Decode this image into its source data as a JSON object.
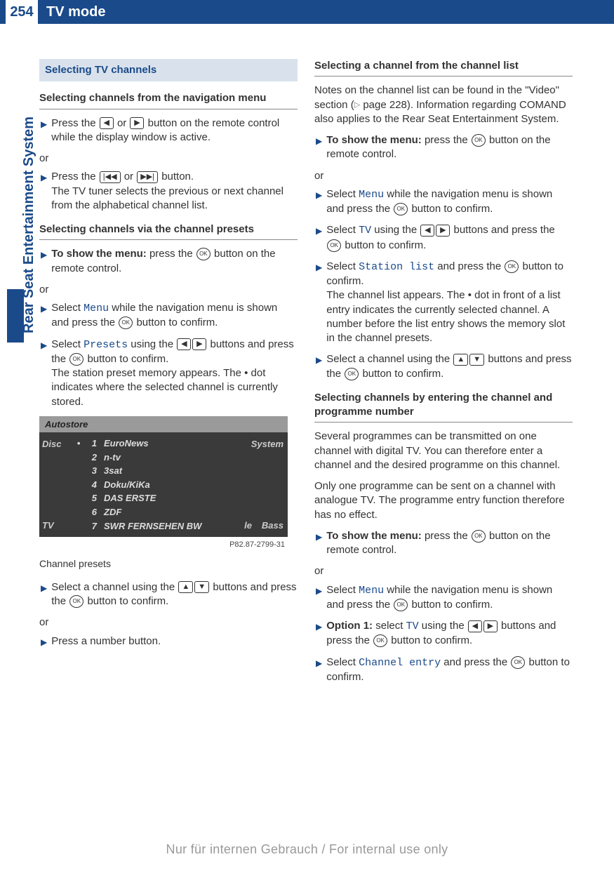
{
  "header": {
    "page": "254",
    "title": "TV mode"
  },
  "sidetab": "Rear Seat Entertainment System",
  "btns": {
    "left": "◀",
    "right": "▶",
    "prev": "|◀◀",
    "next": "▶▶|",
    "ok": "OK",
    "up": "▲",
    "down": "▼",
    "pageref": "▷"
  },
  "left": {
    "sectionHead": "Selecting TV channels",
    "sub1": "Selecting channels from the navigation menu",
    "s1a_a": "Press the ",
    "s1a_b": " or ",
    "s1a_c": " button on the remote control while the display window is active.",
    "or": "or",
    "s1b_a": "Press the ",
    "s1b_b": " or ",
    "s1b_c": " button.",
    "s1b_note": "The TV tuner selects the previous or next channel from the alphabetical channel list.",
    "sub2": "Selecting channels via the channel presets",
    "s2a_a": "To show the menu:",
    "s2a_b": " press the ",
    "s2a_c": " button on the remote control.",
    "s2b_a": "Select ",
    "s2b_cmd": "Menu",
    "s2b_b": " while the navigation menu is shown and press the ",
    "s2b_c": " button to confirm.",
    "s2c_a": "Select ",
    "s2c_cmd": "Presets",
    "s2c_b": " using the ",
    "s2c_c": " buttons and press the ",
    "s2c_d": " button to confirm.",
    "s2c_note": "The station preset memory appears. The • dot indicates where the selected channel is currently stored.",
    "figure": {
      "topLabel": "Autostore",
      "leftTop": "Disc",
      "leftBottom": "TV",
      "rightTop": "System",
      "rightMid": "le",
      "rightBottom": "Bass",
      "rows": [
        {
          "dot": "•",
          "n": "1",
          "name": "EuroNews"
        },
        {
          "dot": "",
          "n": "2",
          "name": "n-tv"
        },
        {
          "dot": "",
          "n": "3",
          "name": "3sat"
        },
        {
          "dot": "",
          "n": "4",
          "name": "Doku/KiKa"
        },
        {
          "dot": "",
          "n": "5",
          "name": "DAS ERSTE"
        },
        {
          "dot": "",
          "n": "6",
          "name": "ZDF"
        },
        {
          "dot": "",
          "n": "7",
          "name": "SWR FERNSEHEN BW"
        }
      ],
      "code": "P82.87-2799-31"
    },
    "caption": "Channel presets",
    "s2d_a": "Select a channel using the ",
    "s2d_b": " buttons and press the ",
    "s2d_c": " button to confirm.",
    "s2e": "Press a number button."
  },
  "right": {
    "sub1": "Selecting a channel from the channel list",
    "p1_a": "Notes on the channel list can be found in the \"Video\" section (",
    "p1_b": " page 228). Information regarding COMAND also applies to the Rear Seat Entertainment System.",
    "s1a_a": "To show the menu:",
    "s1a_b": " press the ",
    "s1a_c": " button on the remote control.",
    "or": "or",
    "s1b_a": "Select ",
    "s1b_cmd": "Menu",
    "s1b_b": " while the navigation menu is shown and press the ",
    "s1b_c": " button to confirm.",
    "s1c_a": "Select ",
    "s1c_cmd": "TV",
    "s1c_b": " using the ",
    "s1c_c": " buttons and press the ",
    "s1c_d": " button to confirm.",
    "s1d_a": "Select ",
    "s1d_cmd": "Station list",
    "s1d_b": " and press the ",
    "s1d_c": " button to confirm.",
    "s1d_note": "The channel list appears. The • dot in front of a list entry indicates the currently selected channel. A number before the list entry shows the memory slot in the channel presets.",
    "s1e_a": "Select a channel using the ",
    "s1e_b": " buttons and press the ",
    "s1e_c": " button to confirm.",
    "sub2": "Selecting channels by entering the channel and programme number",
    "p2": "Several programmes can be transmitted on one channel with digital TV. You can therefore enter a channel and the desired programme on this channel.",
    "p3": "Only one programme can be sent on a channel with analogue TV. The programme entry function therefore has no effect.",
    "s2a_a": "To show the menu:",
    "s2a_b": " press the ",
    "s2a_c": " button on the remote control.",
    "s2b_a": "Select ",
    "s2b_cmd": "Menu",
    "s2b_b": " while the navigation menu is shown and press the ",
    "s2b_c": " button to confirm.",
    "s2c_a": "Option 1:",
    "s2c_b": " select ",
    "s2c_cmd": "TV",
    "s2c_c": " using the ",
    "s2c_d": " buttons and press the ",
    "s2c_e": " button to confirm.",
    "s2d_a": "Select ",
    "s2d_cmd": "Channel entry",
    "s2d_b": " and press the ",
    "s2d_c": " button to confirm."
  },
  "footer": "Nur für internen Gebrauch / For internal use only"
}
